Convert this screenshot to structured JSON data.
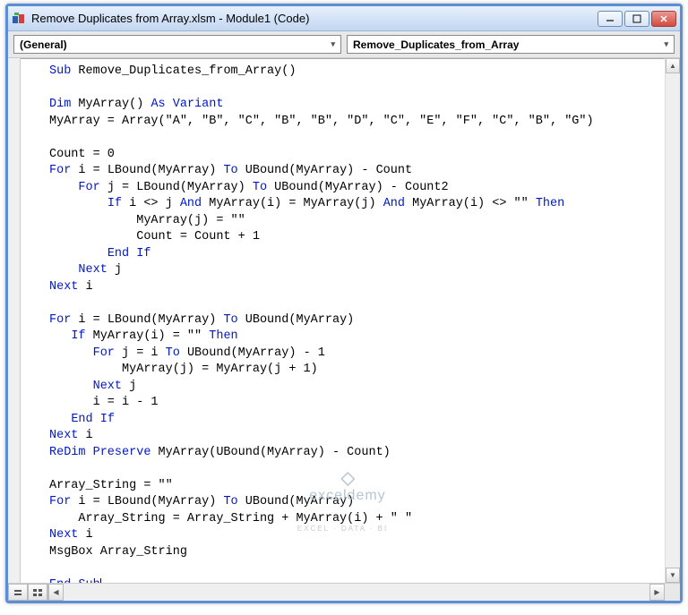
{
  "titlebar": {
    "title": "Remove Duplicates from Array.xlsm - Module1 (Code)"
  },
  "dropdowns": {
    "left": "(General)",
    "right": "Remove_Duplicates_from_Array"
  },
  "code": {
    "l01a": "Sub",
    "l01b": " Remove_Duplicates_from_Array()",
    "l02": "",
    "l03a": "Dim",
    "l03b": " MyArray() ",
    "l03c": "As Variant",
    "l04": "MyArray = Array(\"A\", \"B\", \"C\", \"B\", \"B\", \"D\", \"C\", \"E\", \"F\", \"C\", \"B\", \"G\")",
    "l05": "",
    "l06": "Count = 0",
    "l07a": "For",
    "l07b": " i = LBound(MyArray) ",
    "l07c": "To",
    "l07d": " UBound(MyArray) - Count",
    "l08a": "    ",
    "l08b": "For",
    "l08c": " j = LBound(MyArray) ",
    "l08d": "To",
    "l08e": " UBound(MyArray) - Count2",
    "l09a": "        ",
    "l09b": "If",
    "l09c": " i <> j ",
    "l09d": "And",
    "l09e": " MyArray(i) = MyArray(j) ",
    "l09f": "And",
    "l09g": " MyArray(i) <> \"\" ",
    "l09h": "Then",
    "l10": "            MyArray(j) = \"\"",
    "l11": "            Count = Count + 1",
    "l12a": "        ",
    "l12b": "End If",
    "l13a": "    ",
    "l13b": "Next",
    "l13c": " j",
    "l14a": "Next",
    "l14b": " i",
    "l15": "",
    "l16a": "For",
    "l16b": " i = LBound(MyArray) ",
    "l16c": "To",
    "l16d": " UBound(MyArray)",
    "l17a": "   ",
    "l17b": "If",
    "l17c": " MyArray(i) = \"\" ",
    "l17d": "Then",
    "l18a": "      ",
    "l18b": "For",
    "l18c": " j = i ",
    "l18d": "To",
    "l18e": " UBound(MyArray) - 1",
    "l19": "          MyArray(j) = MyArray(j + 1)",
    "l20a": "      ",
    "l20b": "Next",
    "l20c": " j",
    "l21": "      i = i - 1",
    "l22a": "   ",
    "l22b": "End If",
    "l23a": "Next",
    "l23b": " i",
    "l24a": "ReDim Preserve",
    "l24b": " MyArray(UBound(MyArray) - Count)",
    "l25": "",
    "l26": "Array_String = \"\"",
    "l27a": "For",
    "l27b": " i = LBound(MyArray) ",
    "l27c": "To",
    "l27d": " UBound(MyArray)",
    "l28": "    Array_String = Array_String + MyArray(i) + \" \"",
    "l29a": "Next",
    "l29b": " i",
    "l30": "MsgBox Array_String",
    "l31": "",
    "l32a": "End Sub"
  },
  "watermark": {
    "main": "exceldemy",
    "sub": "EXCEL · DATA · BI"
  }
}
